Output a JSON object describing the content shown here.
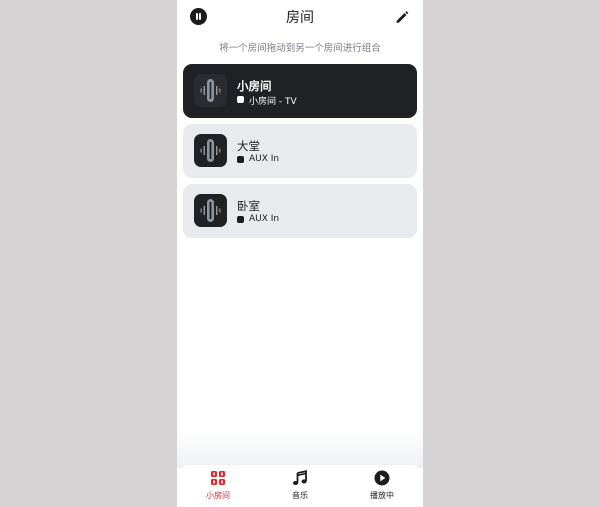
{
  "header": {
    "title": "房间",
    "hint": "将一个房间拖动到另一个房间进行组合",
    "pause_icon": "pause-circle-icon",
    "edit_icon": "pencil-icon"
  },
  "rooms": [
    {
      "name": "小房间",
      "source": "小房间 - TV",
      "active": true,
      "icon": "speaker-waveform-icon"
    },
    {
      "name": "大堂",
      "source": "AUX In",
      "active": false,
      "icon": "speaker-waveform-icon"
    },
    {
      "name": "卧室",
      "source": "AUX In",
      "active": false,
      "icon": "speaker-waveform-icon"
    }
  ],
  "tabs": [
    {
      "label": "小房间",
      "icon": "rooms-grid-icon",
      "selected": true
    },
    {
      "label": "音乐",
      "icon": "music-note-icon",
      "selected": false
    },
    {
      "label": "播放中",
      "icon": "play-circle-icon",
      "selected": false
    }
  ],
  "colors": {
    "background": "#d5d3d4",
    "active_card": "#202125",
    "card": "#e9eaed",
    "accent": "#e0272b"
  }
}
